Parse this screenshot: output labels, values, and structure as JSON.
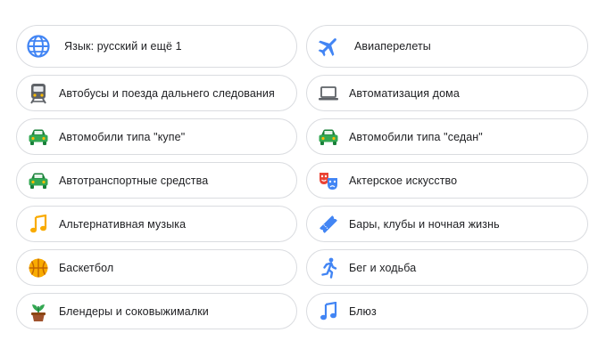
{
  "colors": {
    "border": "#dadce0",
    "text": "#202124",
    "blue": "#4285f4",
    "green": "#34a853",
    "red": "#ea4335",
    "yellow": "#fbbc04",
    "orange": "#f9ab00",
    "gray": "#5f6368",
    "brown": "#795548"
  },
  "left_column": [
    {
      "label": "Язык: русский и ещё 1",
      "icon": "globe-icon"
    },
    {
      "label": "Автобусы и поезда дальнего следования",
      "icon": "train-icon"
    },
    {
      "label": "Автомобили типа \"купе\"",
      "icon": "car-icon"
    },
    {
      "label": "Автотранспортные средства",
      "icon": "car-icon"
    },
    {
      "label": "Альтернативная музыка",
      "icon": "music-note-icon"
    },
    {
      "label": "Баскетбол",
      "icon": "basketball-icon"
    },
    {
      "label": "Блендеры и соковыжималки",
      "icon": "plant-pot-icon"
    }
  ],
  "right_column": [
    {
      "label": "Авиаперелеты",
      "icon": "airplane-icon"
    },
    {
      "label": "Автоматизация дома",
      "icon": "laptop-icon"
    },
    {
      "label": "Автомобили типа \"седан\"",
      "icon": "car-icon"
    },
    {
      "label": "Актерское искусство",
      "icon": "theater-masks-icon"
    },
    {
      "label": "Бары, клубы и ночная жизнь",
      "icon": "ticket-icon"
    },
    {
      "label": "Бег и ходьба",
      "icon": "running-person-icon"
    },
    {
      "label": "Блюз",
      "icon": "music-note-icon"
    }
  ]
}
